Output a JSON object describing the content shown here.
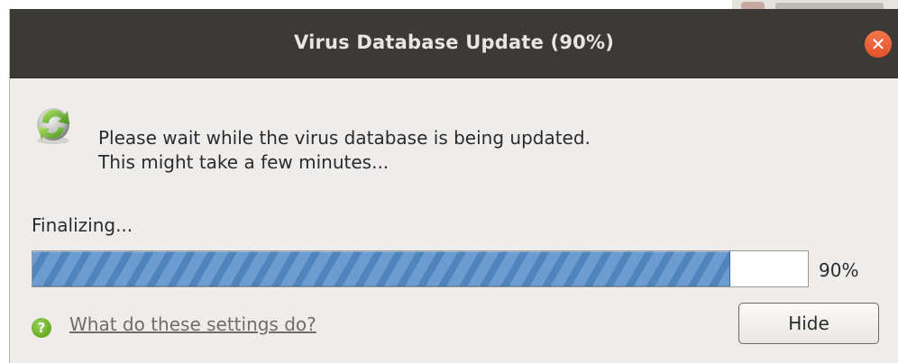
{
  "window": {
    "title": "Virus Database Update (90%)",
    "close_icon": "close-icon"
  },
  "colors": {
    "titlebar": "#3b3a37",
    "close_button": "#e95420",
    "progress_fill": "#5b8fc6",
    "dialog_bg": "#efedeb",
    "help_icon": "#4e9a06"
  },
  "dialog": {
    "update_icon": "update-refresh-icon",
    "message_line1": "Please wait while the virus database is being updated.",
    "message_line2": "This might take a few minutes...",
    "status": "Finalizing...",
    "progress": {
      "value": 0.9,
      "label": "90%"
    },
    "help": {
      "icon": "help-icon",
      "icon_glyph": "?",
      "link_text": "What do these settings do?"
    },
    "hide_button": "Hide"
  }
}
